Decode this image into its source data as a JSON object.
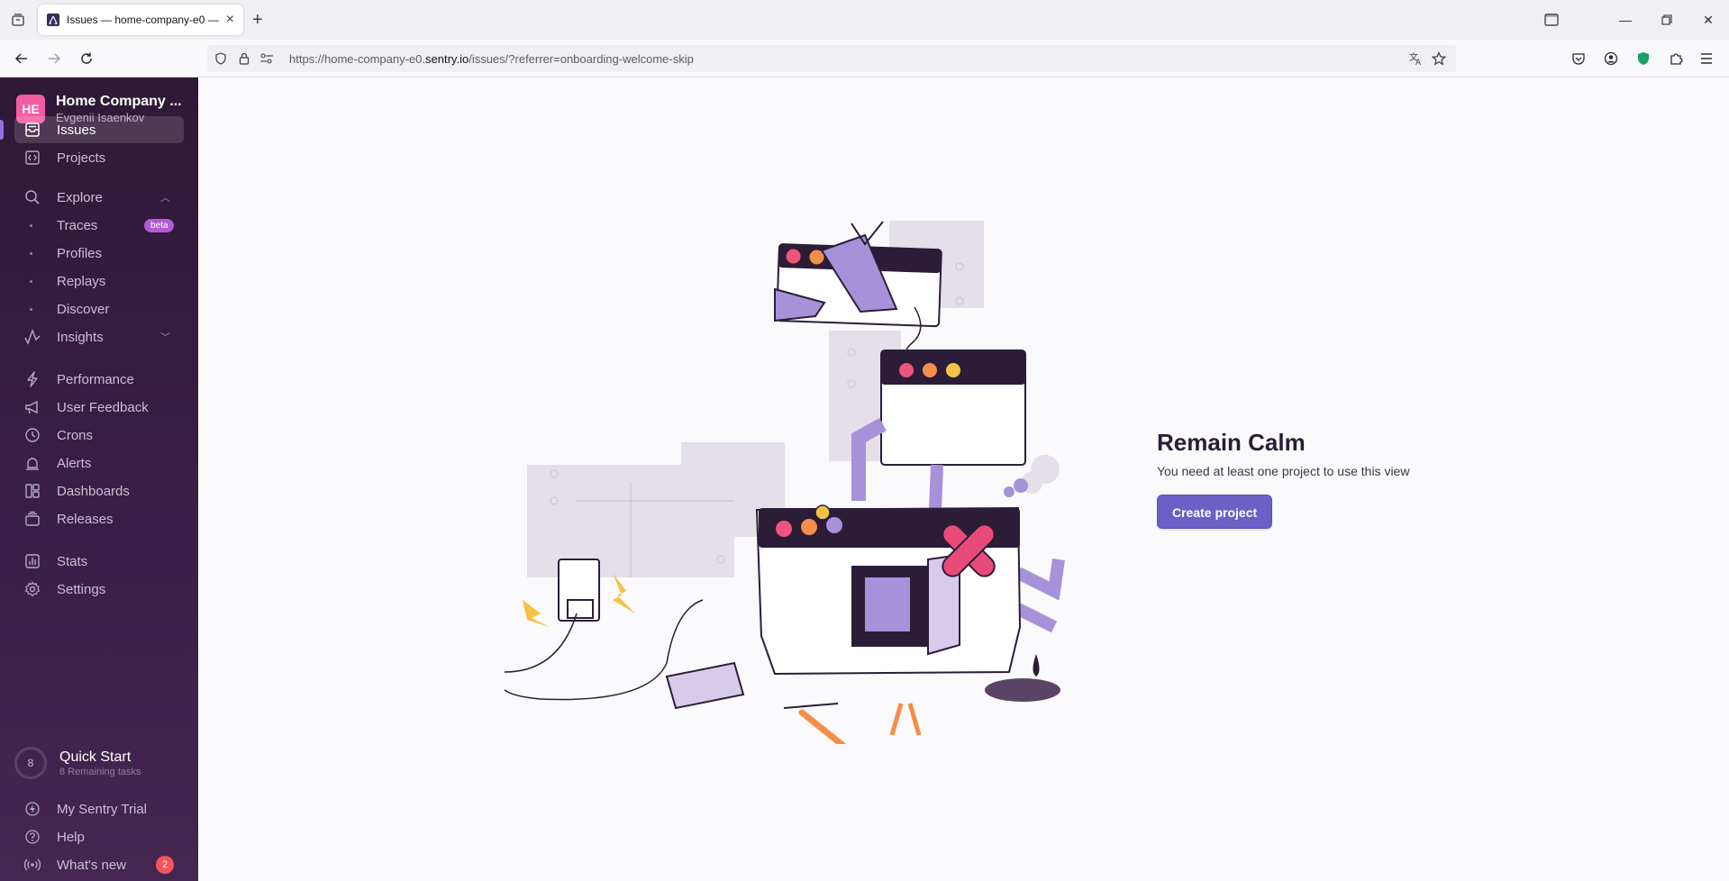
{
  "browser": {
    "tab_title": "Issues — home-company-e0 —",
    "url_prefix": "https://home-company-e0.",
    "url_domain": "sentry.io",
    "url_suffix": "/issues/?referrer=onboarding-welcome-skip"
  },
  "org": {
    "avatar_initials": "HE",
    "name": "Home Company ...",
    "user": "Evgenii Isaenkov"
  },
  "sidebar": {
    "issues": "Issues",
    "projects": "Projects",
    "explore": "Explore",
    "traces": "Traces",
    "traces_badge": "beta",
    "profiles": "Profiles",
    "replays": "Replays",
    "discover": "Discover",
    "insights": "Insights",
    "performance": "Performance",
    "user_feedback": "User Feedback",
    "crons": "Crons",
    "alerts": "Alerts",
    "dashboards": "Dashboards",
    "releases": "Releases",
    "stats": "Stats",
    "settings": "Settings",
    "quickstart_count": "8",
    "quickstart_title": "Quick Start",
    "quickstart_sub": "8 Remaining tasks",
    "trial": "My Sentry Trial",
    "help": "Help",
    "whats_new": "What's new",
    "whats_new_count": "2"
  },
  "empty_state": {
    "title": "Remain Calm",
    "description": "You need at least one project to use this view",
    "button": "Create project"
  },
  "colors": {
    "sidebar_top": "#2f1937",
    "accent": "#6c5fc7",
    "badge": "#f55459"
  }
}
